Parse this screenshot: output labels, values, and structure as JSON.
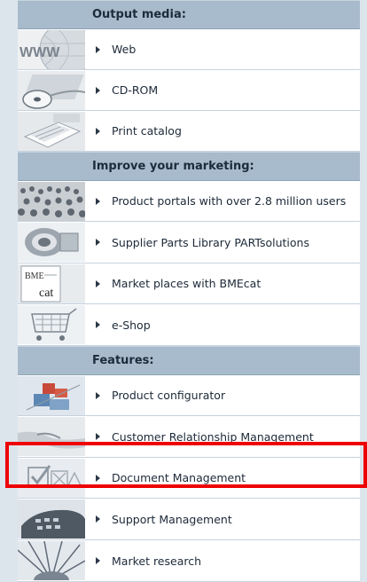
{
  "sections": [
    {
      "header": "Output media:",
      "items": [
        {
          "label": "Web",
          "icon": "www-globe-icon"
        },
        {
          "label": "CD-ROM",
          "icon": "cd-rom-icon"
        },
        {
          "label": "Print catalog",
          "icon": "print-catalog-icon"
        }
      ]
    },
    {
      "header": "Improve your marketing:",
      "items": [
        {
          "label": "Product portals with over 2.8 million users",
          "icon": "crowd-icon"
        },
        {
          "label": "Supplier Parts Library PARTsolutions",
          "icon": "parts-library-icon"
        },
        {
          "label": "Market places with BMEcat",
          "icon": "bmecat-icon"
        },
        {
          "label": "e-Shop",
          "icon": "shopping-cart-icon"
        }
      ]
    },
    {
      "header": "Features:",
      "items": [
        {
          "label": "Product configurator",
          "icon": "configurator-icon"
        },
        {
          "label": "Customer Relationship Management",
          "icon": "handshake-icon"
        },
        {
          "label": "Document Management",
          "icon": "document-checklist-icon"
        },
        {
          "label": "Support Management",
          "icon": "phone-icon"
        },
        {
          "label": "Market research",
          "icon": "radar-icon"
        }
      ]
    }
  ],
  "thumb_text": {
    "www": "WWW",
    "bme": "BME",
    "cat": "cat"
  },
  "colors": {
    "header_bg": "#a8bbcc",
    "highlight": "#ee0000",
    "page_bg": "#dde5ec"
  }
}
